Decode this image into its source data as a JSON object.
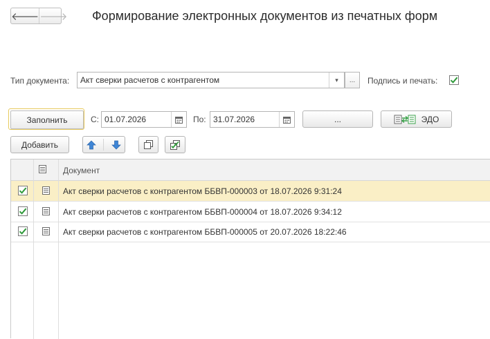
{
  "window": {
    "title": "Формирование электронных  документов из печатных форм"
  },
  "nav": {
    "back_glyph": "🡐",
    "forward_glyph": "🡒"
  },
  "doc_type": {
    "label": "Тип документа:",
    "value": "Акт сверки расчетов с контрагентом",
    "dropdown_glyph": "▾",
    "select_glyph": "..."
  },
  "sign": {
    "label": "Подпись и печать:",
    "checked": true
  },
  "toolbar": {
    "fill_label": "Заполнить",
    "from_label": "С:",
    "from_value": "01.07.2026",
    "to_label": "По:",
    "to_value": "31.07.2026",
    "period_label": "...",
    "edo_label": "ЭДО",
    "add_label": "Добавить"
  },
  "table": {
    "column_header": "Документ",
    "rows": [
      {
        "checked": true,
        "text": "Акт сверки расчетов с контрагентом ББВП-000003 от 18.07.2026 9:31:24",
        "selected": true
      },
      {
        "checked": true,
        "text": "Акт сверки расчетов с контрагентом ББВП-000004 от 18.07.2026 9:34:12",
        "selected": false
      },
      {
        "checked": true,
        "text": "Акт сверки расчетов с контрагентом ББВП-000005 от 20.07.2026 18:22:46",
        "selected": false
      }
    ]
  },
  "colors": {
    "check": "#2f9a3a",
    "arrows": "#3f86d6",
    "selected_row": "#faefc6",
    "primary_border": "#e7c95c"
  }
}
